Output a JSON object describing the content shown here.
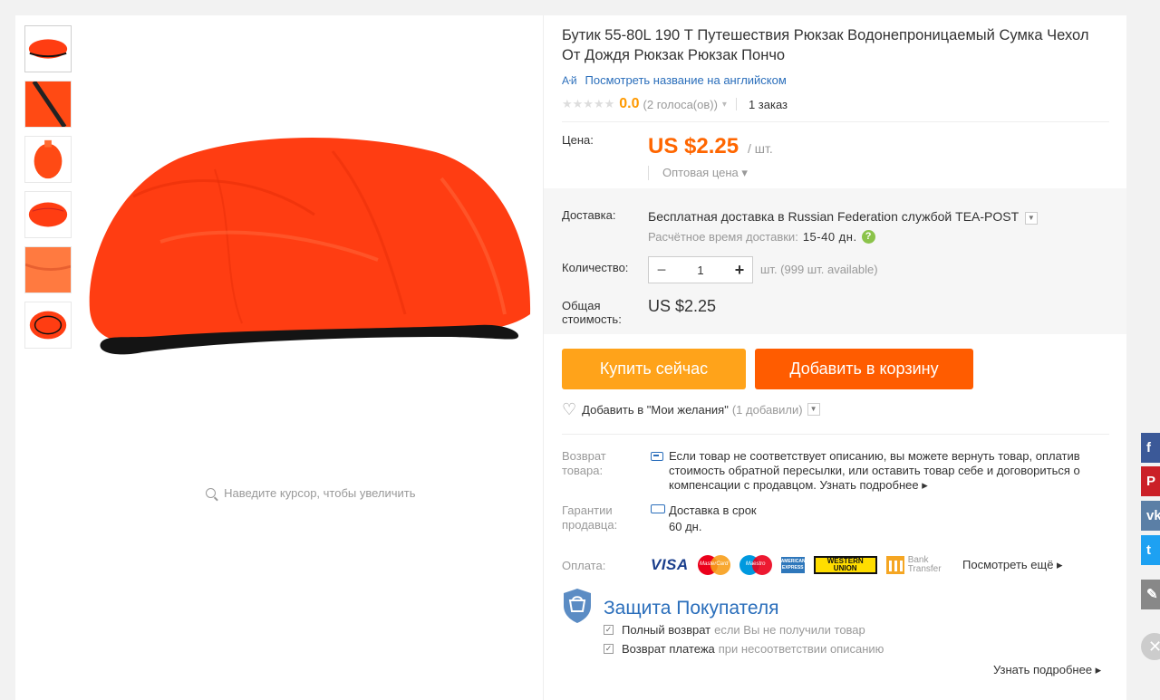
{
  "gallery": {
    "thumbnails": [
      "thumb-1",
      "thumb-2",
      "thumb-3",
      "thumb-4",
      "thumb-5",
      "thumb-6"
    ],
    "zoom_hint": "Наведите курсор, чтобы увеличить"
  },
  "product": {
    "title": "Бутик 55-80L 190 Т Путешествия Рюкзак Водонепроницаемый Сумка Чехол От Дождя Рюкзак Рюкзак Пончо",
    "translate_icon": "A⋅й",
    "translate_link": "Посмотреть название на английском",
    "rating_stars": "★★★★★",
    "rating_value": "0.0",
    "votes": "(2 голоса(ов))",
    "orders": "1 заказ"
  },
  "price": {
    "label": "Цена:",
    "value": "US $2.25",
    "unit": "/ шт.",
    "wholesale": "Оптовая цена ▾"
  },
  "shipping": {
    "label": "Доставка:",
    "free": "Бесплатная доставка",
    "in": "в",
    "country": "Russian Federation",
    "by": "службой",
    "carrier": "TEA-POST",
    "time_label": "Расчётное время доставки:",
    "time_value": "15-40 дн."
  },
  "quantity": {
    "label": "Количество:",
    "minus": "−",
    "value": "1",
    "plus": "+",
    "available": "шт. (999 шт. available)"
  },
  "total": {
    "label": "Общая стоимость:",
    "value": "US $2.25"
  },
  "actions": {
    "buy_now": "Купить сейчас",
    "add_to_cart": "Добавить в корзину",
    "wishlist": "Добавить в \"Мои желания\"",
    "wishlist_count": "(1 добавили)"
  },
  "returns": {
    "label": "Возврат товара:",
    "text": "Если товар не соответствует описанию, вы можете вернуть товар, оплатив стоимость обратной пересылки, или оставить товар себе и договориться о компенсации с продавцом.",
    "more": "Узнать подробнее ▸"
  },
  "guarantee": {
    "label": "Гарантии продавца:",
    "line1": "Доставка в срок",
    "line2": "60 дн."
  },
  "payment": {
    "label": "Оплата:",
    "visa": "VISA",
    "mastercard": "MasterCard",
    "maestro": "Maestro",
    "amex": "AMERICAN EXPRESS",
    "western_union": "WESTERN UNION",
    "bank_line1": "Bank",
    "bank_line2": "Transfer",
    "more": "Посмотреть ещё ▸"
  },
  "protection": {
    "title": "Защита Покупателя",
    "item1_bold": "Полный возврат",
    "item1_rest": "если Вы не получили товар",
    "item2_bold": "Возврат платежа",
    "item2_rest": "при несоответствии описанию",
    "learn_more": "Узнать подробнее ▸"
  },
  "share": {
    "facebook": "f",
    "pinterest": "P",
    "vk": "vk",
    "twitter": "t",
    "edit": "✎",
    "close": "✕"
  },
  "colors": {
    "accent_orange": "#ff5c00",
    "buy_orange": "#ffa31a",
    "price_orange": "#ff6600",
    "link_blue": "#2a6ebb",
    "product_red": "#ff3d12"
  }
}
